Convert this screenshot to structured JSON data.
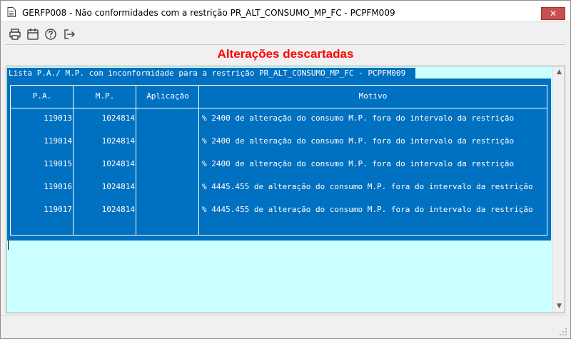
{
  "window": {
    "title": "GERFP008 - Não conformidades com a restrição PR_ALT_CONSUMO_MP_FC - PCPFM009",
    "close_label": "✕"
  },
  "toolbar": {
    "buttons": [
      {
        "icon": "printer-icon",
        "glyph": "🖶"
      },
      {
        "icon": "calendar-icon",
        "glyph": "📅"
      },
      {
        "icon": "help-icon",
        "glyph": "?"
      },
      {
        "icon": "exit-icon",
        "glyph": "⇥"
      }
    ]
  },
  "heading": "Alterações descartadas",
  "panel": {
    "caption": "Lista P.A./ M.P. com inconformidade para a restrição PR_ALT_CONSUMO_MP_FC - PCPFM009",
    "columns": [
      "P.A.",
      "M.P.",
      "Aplicação",
      "Motivo"
    ],
    "rows": [
      {
        "pa": "119013",
        "mp": "1024814",
        "aplicacao": "",
        "motivo": "% 2400 de alteração do consumo M.P. fora do intervalo da restrição"
      },
      {
        "pa": "119014",
        "mp": "1024814",
        "aplicacao": "",
        "motivo": "% 2400 de alteração do consumo M.P. fora do intervalo da restrição"
      },
      {
        "pa": "119015",
        "mp": "1024814",
        "aplicacao": "",
        "motivo": "% 2400 de alteração do consumo M.P. fora do intervalo da restrição"
      },
      {
        "pa": "119016",
        "mp": "1024814",
        "aplicacao": "",
        "motivo": "% 4445.455 de alteração do consumo M.P. fora do intervalo da restrição"
      },
      {
        "pa": "119017",
        "mp": "1024814",
        "aplicacao": "",
        "motivo": "% 4445.455 de alteração do consumo M.P. fora do intervalo da restrição"
      }
    ]
  },
  "colors": {
    "heading": "#ff0000",
    "panel_bg": "#ccffff",
    "grid_bg": "#0070c0",
    "close_button": "#c75050"
  }
}
